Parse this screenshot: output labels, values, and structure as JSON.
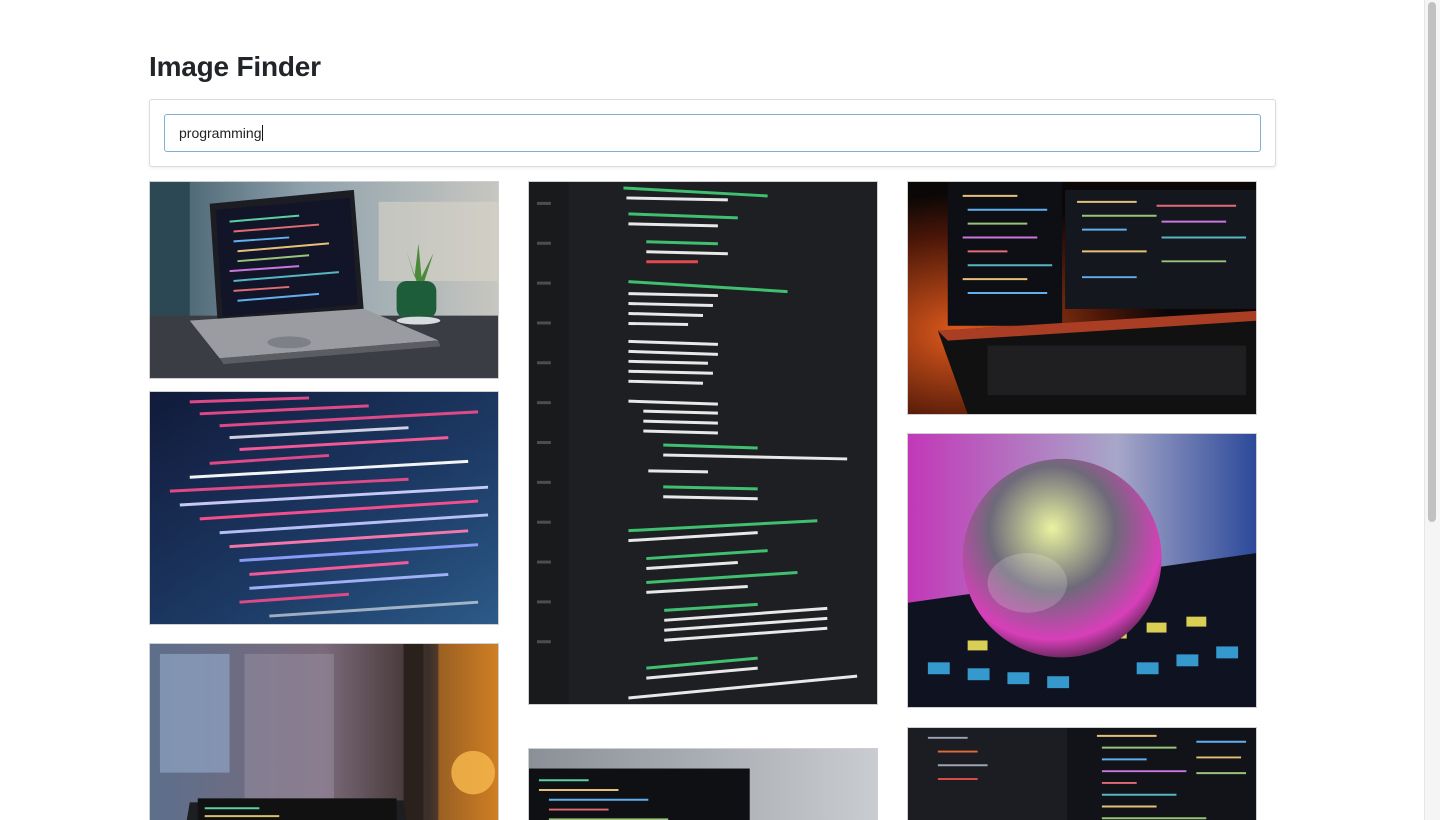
{
  "header": {
    "title": "Image Finder"
  },
  "search": {
    "value": "programming"
  },
  "results": [
    {
      "name": "laptop-code-on-desk"
    },
    {
      "name": "code-editor-closeup"
    },
    {
      "name": "dual-monitor-keyboard"
    },
    {
      "name": "svg-markup-screen"
    },
    {
      "name": "crystal-ball-on-keyboard"
    },
    {
      "name": "laptop-by-window-lamp"
    },
    {
      "name": "monitor-code-editor"
    },
    {
      "name": "code-on-dark-monitors"
    }
  ],
  "colors": {
    "title": "#212529",
    "input_border": "#7fb0d6"
  }
}
